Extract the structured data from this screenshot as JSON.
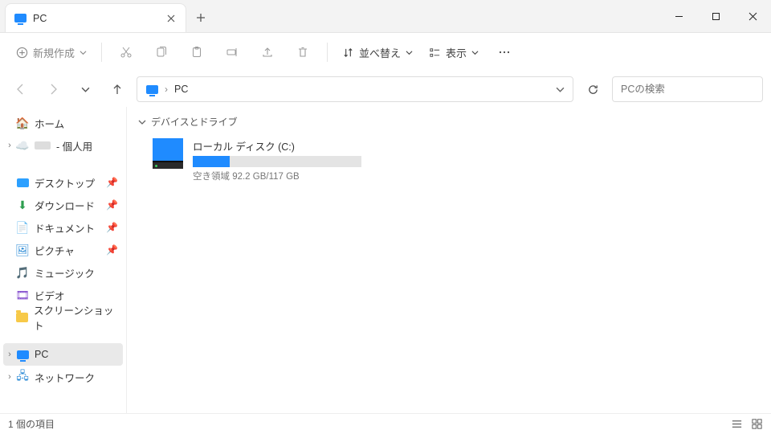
{
  "window": {
    "tab_title": "PC",
    "new_tab_tooltip": "+"
  },
  "toolbar": {
    "new_label": "新規作成",
    "sort_label": "並べ替え",
    "view_label": "表示"
  },
  "breadcrumb": {
    "root": "PC"
  },
  "search": {
    "placeholder": "PCの検索"
  },
  "sidebar": {
    "home": "ホーム",
    "onedrive_suffix": "- 個人用",
    "desktop": "デスクトップ",
    "downloads": "ダウンロード",
    "documents": "ドキュメント",
    "pictures": "ピクチャ",
    "music": "ミュージック",
    "videos": "ビデオ",
    "screenshots": "スクリーンショット",
    "pc": "PC",
    "network": "ネットワーク"
  },
  "content": {
    "group_header": "デバイスとドライブ",
    "drive_name": "ローカル ディスク (C:)",
    "drive_free_text": "空き領域 92.2 GB/117 GB",
    "drive_used_percent": 22
  },
  "status": {
    "item_count_text": "1 個の項目"
  }
}
